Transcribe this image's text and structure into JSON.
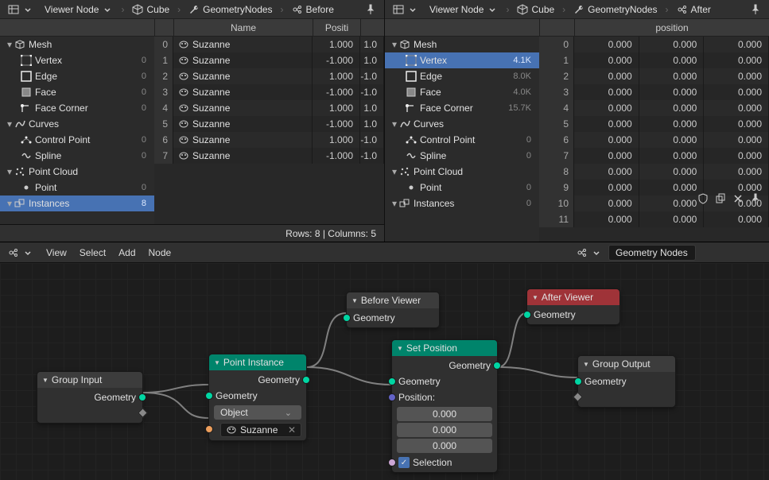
{
  "left": {
    "breadcrumb": {
      "mode": "Viewer Node",
      "obj": "Cube",
      "ng": "GeometryNodes",
      "viewer": "Before"
    },
    "tree": [
      {
        "kind": "group",
        "icon": "mesh",
        "label": "Mesh",
        "count": ""
      },
      {
        "kind": "item",
        "icon": "vertex",
        "label": "Vertex",
        "count": "0"
      },
      {
        "kind": "item",
        "icon": "edge",
        "label": "Edge",
        "count": "0"
      },
      {
        "kind": "item",
        "icon": "face",
        "label": "Face",
        "count": "0"
      },
      {
        "kind": "item",
        "icon": "corner",
        "label": "Face Corner",
        "count": "0"
      },
      {
        "kind": "group",
        "icon": "curves",
        "label": "Curves",
        "count": ""
      },
      {
        "kind": "item",
        "icon": "cpoint",
        "label": "Control Point",
        "count": "0"
      },
      {
        "kind": "item",
        "icon": "spline",
        "label": "Spline",
        "count": "0"
      },
      {
        "kind": "group",
        "icon": "pcloud",
        "label": "Point Cloud",
        "count": ""
      },
      {
        "kind": "item",
        "icon": "point",
        "label": "Point",
        "count": "0"
      },
      {
        "kind": "group",
        "icon": "inst",
        "label": "Instances",
        "count": "8",
        "selected": true
      }
    ],
    "cols": [
      "",
      "Name",
      "Positi"
    ],
    "rows": [
      {
        "i": 0,
        "name": "Suzanne",
        "v": [
          "1.000",
          "1.0"
        ]
      },
      {
        "i": 1,
        "name": "Suzanne",
        "v": [
          "-1.000",
          "1.0"
        ]
      },
      {
        "i": 2,
        "name": "Suzanne",
        "v": [
          "1.000",
          "-1.0"
        ]
      },
      {
        "i": 3,
        "name": "Suzanne",
        "v": [
          "-1.000",
          "-1.0"
        ]
      },
      {
        "i": 4,
        "name": "Suzanne",
        "v": [
          "1.000",
          "1.0"
        ]
      },
      {
        "i": 5,
        "name": "Suzanne",
        "v": [
          "-1.000",
          "1.0"
        ]
      },
      {
        "i": 6,
        "name": "Suzanne",
        "v": [
          "1.000",
          "-1.0"
        ]
      },
      {
        "i": 7,
        "name": "Suzanne",
        "v": [
          "-1.000",
          "-1.0"
        ]
      }
    ],
    "status": "Rows: 8   |   Columns: 5"
  },
  "right": {
    "breadcrumb": {
      "mode": "Viewer Node",
      "obj": "Cube",
      "ng": "GeometryNodes",
      "viewer": "After"
    },
    "tree": [
      {
        "kind": "group",
        "icon": "mesh",
        "label": "Mesh",
        "count": ""
      },
      {
        "kind": "item",
        "icon": "vertex",
        "label": "Vertex",
        "count": "4.1K",
        "selected": true
      },
      {
        "kind": "item",
        "icon": "edge",
        "label": "Edge",
        "count": "8.0K"
      },
      {
        "kind": "item",
        "icon": "face",
        "label": "Face",
        "count": "4.0K"
      },
      {
        "kind": "item",
        "icon": "corner",
        "label": "Face Corner",
        "count": "15.7K"
      },
      {
        "kind": "group",
        "icon": "curves",
        "label": "Curves",
        "count": ""
      },
      {
        "kind": "item",
        "icon": "cpoint",
        "label": "Control Point",
        "count": "0"
      },
      {
        "kind": "item",
        "icon": "spline",
        "label": "Spline",
        "count": "0"
      },
      {
        "kind": "group",
        "icon": "pcloud",
        "label": "Point Cloud",
        "count": ""
      },
      {
        "kind": "item",
        "icon": "point",
        "label": "Point",
        "count": "0"
      },
      {
        "kind": "group",
        "icon": "inst",
        "label": "Instances",
        "count": "0"
      }
    ],
    "cols": [
      "",
      "position",
      "",
      ""
    ],
    "rows": [
      {
        "i": 0,
        "v": [
          "0.000",
          "0.000",
          "0.000"
        ]
      },
      {
        "i": 1,
        "v": [
          "0.000",
          "0.000",
          "0.000"
        ]
      },
      {
        "i": 2,
        "v": [
          "0.000",
          "0.000",
          "0.000"
        ]
      },
      {
        "i": 3,
        "v": [
          "0.000",
          "0.000",
          "0.000"
        ]
      },
      {
        "i": 4,
        "v": [
          "0.000",
          "0.000",
          "0.000"
        ]
      },
      {
        "i": 5,
        "v": [
          "0.000",
          "0.000",
          "0.000"
        ]
      },
      {
        "i": 6,
        "v": [
          "0.000",
          "0.000",
          "0.000"
        ]
      },
      {
        "i": 7,
        "v": [
          "0.000",
          "0.000",
          "0.000"
        ]
      },
      {
        "i": 8,
        "v": [
          "0.000",
          "0.000",
          "0.000"
        ]
      },
      {
        "i": 9,
        "v": [
          "0.000",
          "0.000",
          "0.000"
        ]
      },
      {
        "i": 10,
        "v": [
          "0.000",
          "0.000",
          "0.000"
        ]
      },
      {
        "i": 11,
        "v": [
          "0.000",
          "0.000",
          "0.000"
        ]
      }
    ]
  },
  "ne": {
    "menus": [
      "View",
      "Select",
      "Add",
      "Node"
    ],
    "ng_name": "Geometry Nodes",
    "nodes": {
      "group_input": {
        "title": "Group Input",
        "sock_out": "Geometry"
      },
      "point_instance": {
        "title": "Point Instance",
        "sock_out": "Geometry",
        "sock_in_geo": "Geometry",
        "dd": "Object",
        "obj": "Suzanne"
      },
      "before_viewer": {
        "title": "Before Viewer",
        "sock_in": "Geometry"
      },
      "set_position": {
        "title": "Set Position",
        "sock_out": "Geometry",
        "sock_in_geo": "Geometry",
        "lbl_pos": "Position:",
        "pos": [
          "0.000",
          "0.000",
          "0.000"
        ],
        "sel_label": "Selection"
      },
      "after_viewer": {
        "title": "After Viewer",
        "sock_in": "Geometry"
      },
      "group_output": {
        "title": "Group Output",
        "sock_in": "Geometry"
      }
    }
  }
}
